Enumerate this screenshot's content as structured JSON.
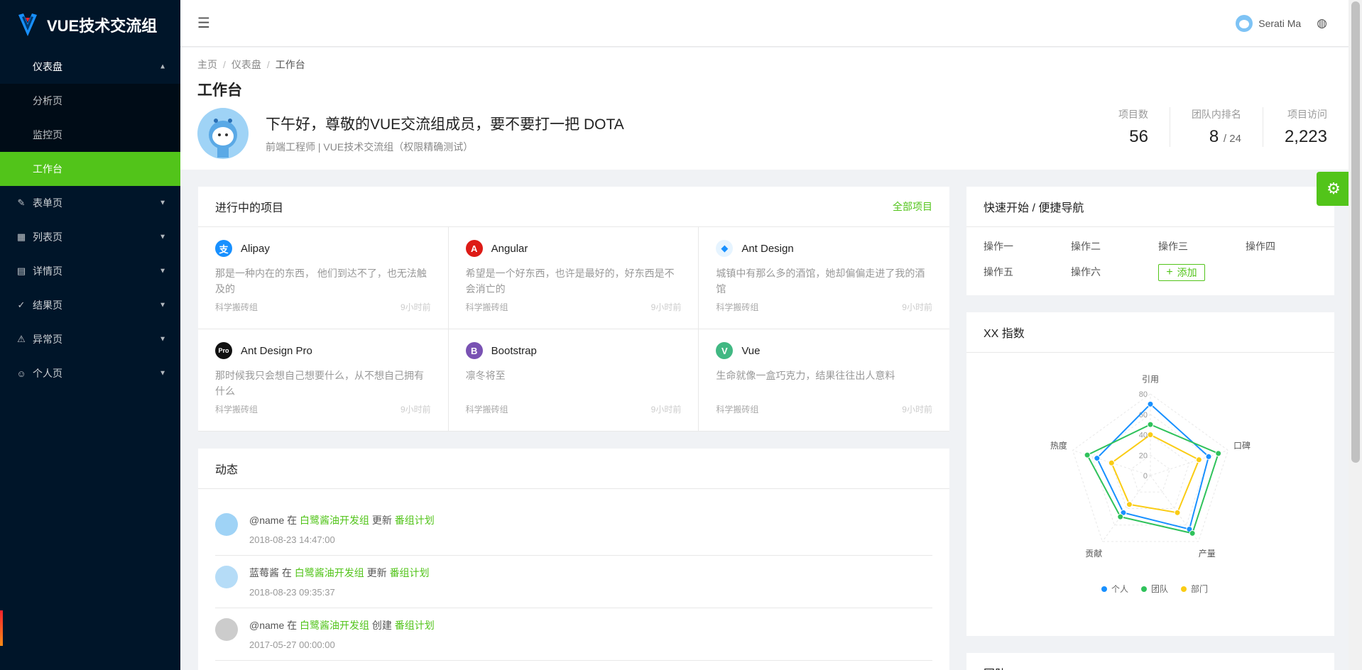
{
  "app": {
    "title": "VUE技术交流组"
  },
  "sidebar": {
    "group": {
      "label": "仪表盘",
      "children": [
        "分析页",
        "监控页",
        "工作台"
      ],
      "active": "工作台"
    },
    "items": [
      {
        "label": "表单页",
        "icon": "form-icon"
      },
      {
        "label": "列表页",
        "icon": "table-icon"
      },
      {
        "label": "详情页",
        "icon": "profile-icon"
      },
      {
        "label": "结果页",
        "icon": "check-circle-icon"
      },
      {
        "label": "异常页",
        "icon": "warning-icon"
      },
      {
        "label": "个人页",
        "icon": "user-icon"
      }
    ]
  },
  "header": {
    "user": "Serati Ma"
  },
  "breadcrumb": [
    "主页",
    "仪表盘",
    "工作台"
  ],
  "page": {
    "title": "工作台",
    "greeting": "下午好，尊敬的VUE交流组成员，要不要打一把 DOTA",
    "subtitle": "前端工程师 | VUE技术交流组（权限精确测试）"
  },
  "stats": [
    {
      "label": "项目数",
      "value": "56",
      "suffix": ""
    },
    {
      "label": "团队内排名",
      "value": "8",
      "suffix": "/ 24"
    },
    {
      "label": "项目访问",
      "value": "2,223",
      "suffix": ""
    }
  ],
  "projects_card": {
    "title": "进行中的项目",
    "extra": "全部项目"
  },
  "projects": [
    {
      "name": "Alipay",
      "desc": "那是一种内在的东西， 他们到达不了，也无法触及的",
      "group": "科学搬砖组",
      "time": "9小时前",
      "color": "#1890ff",
      "letter": "支"
    },
    {
      "name": "Angular",
      "desc": "希望是一个好东西，也许是最好的，好东西是不会消亡的",
      "group": "科学搬砖组",
      "time": "9小时前",
      "color": "#dd1b16",
      "letter": "A"
    },
    {
      "name": "Ant Design",
      "desc": "城镇中有那么多的酒馆，她却偏偏走进了我的酒馆",
      "group": "科学搬砖组",
      "time": "9小时前",
      "color": "#e6f4ff",
      "letter": "◆"
    },
    {
      "name": "Ant Design Pro",
      "desc": "那时候我只会想自己想要什么，从不想自己拥有什么",
      "group": "科学搬砖组",
      "time": "9小时前",
      "color": "#111111",
      "letter": "Pro"
    },
    {
      "name": "Bootstrap",
      "desc": "凛冬将至",
      "group": "科学搬砖组",
      "time": "9小时前",
      "color": "#7952b3",
      "letter": "B"
    },
    {
      "name": "Vue",
      "desc": "生命就像一盒巧克力，结果往往出人意料",
      "group": "科学搬砖组",
      "time": "9小时前",
      "color": "#41b883",
      "letter": "V"
    }
  ],
  "quick_nav": {
    "title": "快速开始 / 便捷导航",
    "links": [
      "操作一",
      "操作二",
      "操作三",
      "操作四",
      "操作五",
      "操作六"
    ],
    "add_label": "添加"
  },
  "activity_card": {
    "title": "动态"
  },
  "activities": [
    {
      "user": "@name",
      "in": "在",
      "group": "白鹭酱油开发组",
      "verb": "更新",
      "project": "番组计划",
      "time": "2018-08-23 14:47:00",
      "avatar": "#9fd3f6"
    },
    {
      "user": "蓝莓酱",
      "in": "在",
      "group": "白鹭酱油开发组",
      "verb": "更新",
      "project": "番组计划",
      "time": "2018-08-23 09:35:37",
      "avatar": "#b5dcf7"
    },
    {
      "user": "@name",
      "in": "在",
      "group": "白鹭酱油开发组",
      "verb": "创建",
      "project": "番组计划",
      "time": "2017-05-27 00:00:00",
      "avatar": "#cccccc"
    }
  ],
  "radar_card": {
    "title": "XX 指数"
  },
  "chart_data": {
    "type": "radar",
    "indicators": [
      "引用",
      "口碑",
      "产量",
      "贡献",
      "热度"
    ],
    "ticks": [
      0,
      20,
      40,
      60,
      80
    ],
    "max": 80,
    "series": [
      {
        "name": "个人",
        "color": "#1890ff",
        "values": [
          70,
          60,
          65,
          45,
          55
        ]
      },
      {
        "name": "团队",
        "color": "#2fc25b",
        "values": [
          50,
          70,
          70,
          50,
          65
        ]
      },
      {
        "name": "部门",
        "color": "#facc14",
        "values": [
          40,
          50,
          45,
          35,
          40
        ]
      }
    ]
  },
  "bottom_card": {
    "title": "团队"
  }
}
